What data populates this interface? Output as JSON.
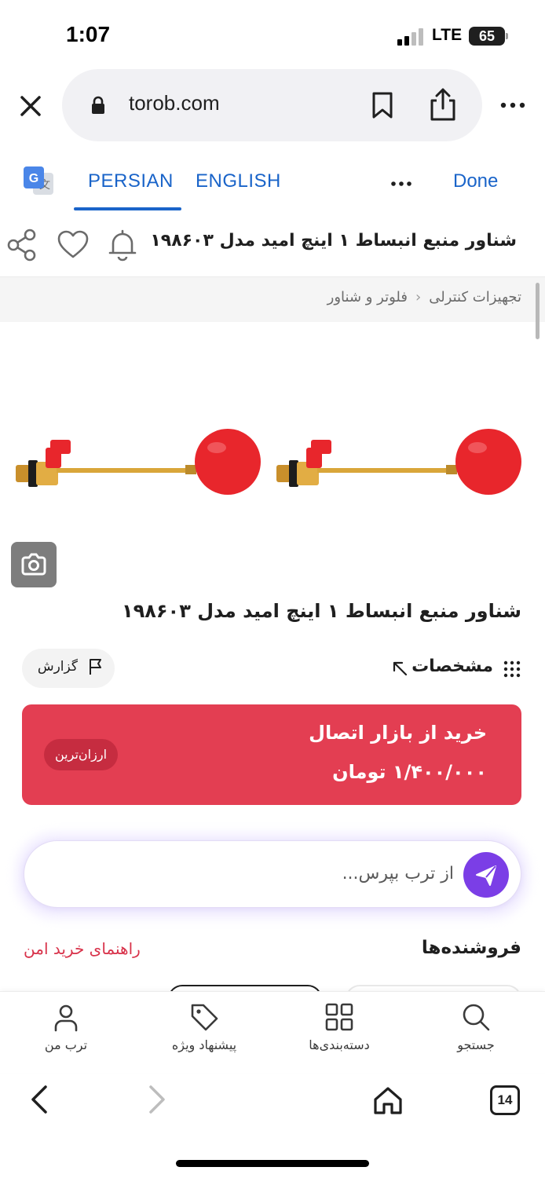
{
  "status_bar": {
    "time": "1:07",
    "network": "LTE",
    "battery": "65"
  },
  "browser": {
    "url": "torob.com",
    "tabs_count": "14"
  },
  "translate_bar": {
    "tab_persian": "PERSIAN",
    "tab_english": "ENGLISH",
    "done": "Done"
  },
  "product": {
    "header_title": "شناور منبع انبساط ۱ اینچ امید مدل ۱۹۸۶۰۳",
    "breadcrumb": [
      "تجهیزات کنترلی",
      "فلوتر و شناور"
    ],
    "title": "شناور منبع انبساط ۱ اینچ امید مدل ۱۹۸۶۰۳",
    "specs_label": "مشخصات",
    "report_label": "گزارش"
  },
  "buy_card": {
    "store": "خرید از بازار اتصال",
    "price": "۱/۴۰۰/۰۰۰ تومان",
    "badge": "ارزان‌ترین"
  },
  "ask": {
    "placeholder": "از ترب بپرس..."
  },
  "sellers": {
    "title": "فروشنده‌ها",
    "safe_guide": "راهنمای خرید امن"
  },
  "bottom_nav": {
    "search": "جستجو",
    "categories": "دسته‌بندی‌ها",
    "offers": "پیشنهاد ویژه",
    "my_torob": "ترب من"
  },
  "colors": {
    "accent_red": "#e33e52",
    "link_blue": "#1a64c9",
    "ask_purple": "#7b3ee6",
    "product_ball": "#e8262c",
    "brass": "#d9a63a"
  }
}
